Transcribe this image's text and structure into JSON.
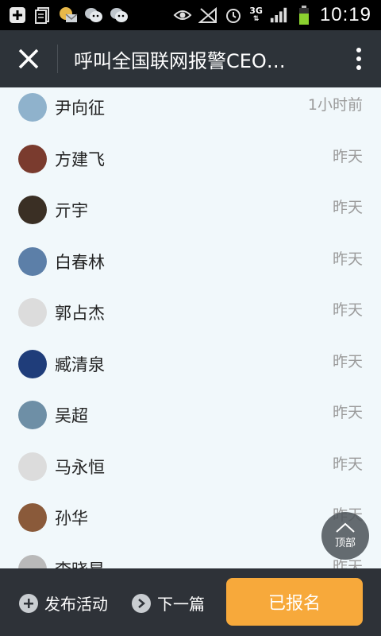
{
  "status_bar": {
    "time": "10:19",
    "network": "3G",
    "icons": [
      "add-icon",
      "notes-icon",
      "mail-icon",
      "wechat-icon",
      "wechat-icon",
      "eye-icon",
      "signal-off-icon",
      "alarm-icon"
    ]
  },
  "header": {
    "title": "呼叫全国联网报警CEO…"
  },
  "list": {
    "items": [
      {
        "name": "尹向征",
        "time": "1小时前",
        "avatar_color": "#8fb2cc"
      },
      {
        "name": "方建飞",
        "time": "昨天",
        "avatar_color": "#7a3b2e"
      },
      {
        "name": "亓宇",
        "time": "昨天",
        "avatar_color": "#3a2f24"
      },
      {
        "name": "白春林",
        "time": "昨天",
        "avatar_color": "#5c7fa8"
      },
      {
        "name": "郭占杰",
        "time": "昨天",
        "avatar_color": "#dcdcdc"
      },
      {
        "name": "臧清泉",
        "time": "昨天",
        "avatar_color": "#1f3d7a"
      },
      {
        "name": "吴超",
        "time": "昨天",
        "avatar_color": "#6e8fa6"
      },
      {
        "name": "马永恒",
        "time": "昨天",
        "avatar_color": "#dcdcdc"
      },
      {
        "name": "孙华",
        "time": "昨天",
        "avatar_color": "#8a5a3a"
      },
      {
        "name": "李晓星",
        "time": "昨天",
        "avatar_color": "#b9b9b9"
      }
    ]
  },
  "top_button": {
    "label": "顶部"
  },
  "bottom_bar": {
    "publish_label": "发布活动",
    "next_label": "下一篇",
    "signed_label": "已报名"
  },
  "colors": {
    "status_bar_bg": "#000000",
    "header_bg": "#2d3339",
    "list_bg": "#f1f8fb",
    "bottom_bar_bg": "#2e3238",
    "accent": "#f7a93b"
  }
}
